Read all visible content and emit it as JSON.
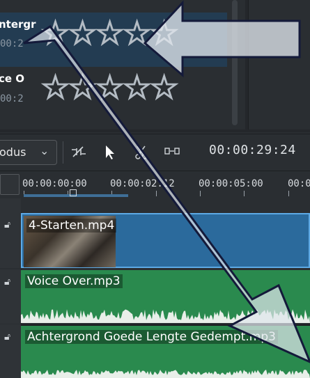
{
  "clip_list": {
    "items": [
      {
        "name": "Achtergrond Goede Lengte Gedempt.mp3",
        "visible_name": "ntergr",
        "duration": "00:2",
        "rating_stars": "☆☆☆☆☆",
        "selected": true
      },
      {
        "name": "Voice Over.mp3",
        "visible_name": "ce O",
        "duration": "00:2",
        "rating_stars": "☆☆☆☆☆",
        "selected": false
      }
    ]
  },
  "toolbar": {
    "mode_label": "odus",
    "timecode": "00:00:29:24"
  },
  "ruler": {
    "labels": [
      "00:00:00:00",
      "00:00:02:12",
      "00:00:05:00",
      "00:0"
    ]
  },
  "tracks": [
    {
      "clip_label": "4-Starten.mp4",
      "kind": "video"
    },
    {
      "clip_label": "Voice Over.mp3",
      "kind": "audio"
    },
    {
      "clip_label": "Achtergrond Goede Lengte Gedempt.mp3",
      "kind": "audio"
    }
  ],
  "colors": {
    "selection": "#233c52",
    "video_clip": "#2b6a9c",
    "audio_clip": "#2a8a4e",
    "arrow_fill": "#dfe6ec"
  }
}
